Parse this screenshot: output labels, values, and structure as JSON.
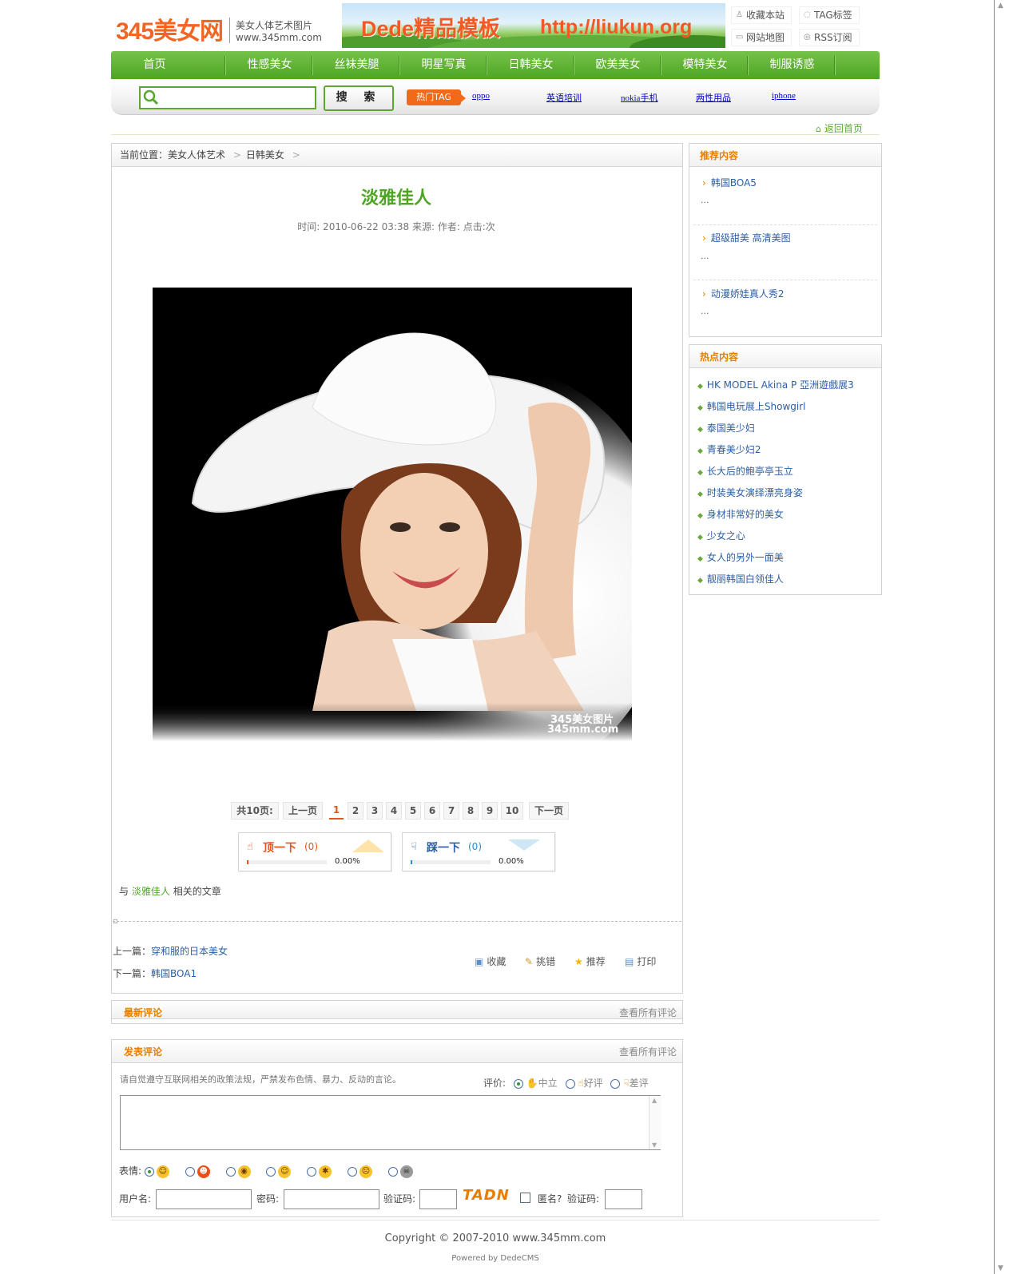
{
  "header": {
    "logo": "345美女网",
    "tagline1": "美女人体艺术图片",
    "tagline2": "www.345mm.com",
    "banner_text1": "Dede精品模板",
    "banner_text2": "http://liukun.org",
    "top_links": [
      "收藏本站",
      "TAG标签",
      "网站地图",
      "RSS订阅"
    ]
  },
  "nav": {
    "items": [
      "首页",
      "性感美女",
      "丝袜美腿",
      "明星写真",
      "日韩美女",
      "欧美美女",
      "模特美女",
      "制服诱惑"
    ]
  },
  "search": {
    "placeholder": "",
    "button": "搜 索",
    "hot_tag_label": "热门TAG",
    "hot_links": [
      "oppo",
      "英语培训",
      "nokia手机",
      "两性用品",
      "iphone"
    ]
  },
  "back_home": "返回首页",
  "breadcrumb": {
    "prefix": "当前位置：",
    "items": [
      "美女人体艺术",
      "日韩美女"
    ],
    "sep": ">"
  },
  "article": {
    "title": "淡雅佳人",
    "meta": "时间: 2010-06-22 03:38  来源:   作者:   点击:次",
    "watermark1": "345美女图片",
    "watermark2": "345mm.com"
  },
  "pager": {
    "total": "共10页:",
    "prev": "上一页",
    "pages": [
      "1",
      "2",
      "3",
      "4",
      "5",
      "6",
      "7",
      "8",
      "9",
      "10"
    ],
    "current": "1",
    "next": "下一页"
  },
  "vote": {
    "up": {
      "label": "顶一下",
      "count": "(0)",
      "percent": "0.00%",
      "ratio": 0.0
    },
    "down": {
      "label": "踩一下",
      "count": "(0)",
      "percent": "0.00%",
      "ratio": 0.0
    }
  },
  "related": {
    "prefix": "与",
    "keyword": "淡雅佳人",
    "suffix": "相关的文章"
  },
  "prevnext": {
    "prev_label": "上一篇：",
    "prev_title": "穿和服的日本美女",
    "next_label": "下一篇：",
    "next_title": "韩国BOA1"
  },
  "actions": [
    "收藏",
    "挑错",
    "推荐",
    "打印"
  ],
  "comments": {
    "latest_title": "最新评论",
    "post_title": "发表评论",
    "view_all": "查看所有评论",
    "notice": "请自觉遵守互联网相关的政策法规，严禁发布色情、暴力、反动的言论。",
    "rate_label": "评价:",
    "rate_options": [
      "中立",
      "好评",
      "差评"
    ],
    "face_label": "表情:",
    "username_label": "用户名:",
    "password_label": "密码:",
    "captcha_label": "验证码:",
    "captcha_text": "TADN",
    "anon_label": "匿名?",
    "captcha_label2": "验证码:"
  },
  "sidebar": {
    "recommend_title": "推荐内容",
    "recommend": [
      {
        "title": "韩国BOA5",
        "more": "..."
      },
      {
        "title": "超级甜美 高清美图",
        "more": "..."
      },
      {
        "title": "动漫娇娃真人秀2",
        "more": "..."
      }
    ],
    "hot_title": "热点内容",
    "hot": [
      "HK MODEL Akina P 亞洲遊戲展3",
      "韩国电玩展上Showgirl",
      "泰国美少妇",
      "青春美少妇2",
      "长大后的鲍亭亭玉立",
      "时装美女演绎漂亮身姿",
      "身材非常好的美女",
      "少女之心",
      "女人的另外一面美",
      "靓丽韩国白领佳人"
    ]
  },
  "footer": {
    "copyright": "Copyright © 2007-2010 www.345mm.com",
    "powered": "Powered by DedeCMS"
  },
  "colors": {
    "nav_green": "#5aa82f",
    "title_green": "#4ea523",
    "accent_orange": "#e57f00",
    "link_blue": "#2b5fa6"
  }
}
